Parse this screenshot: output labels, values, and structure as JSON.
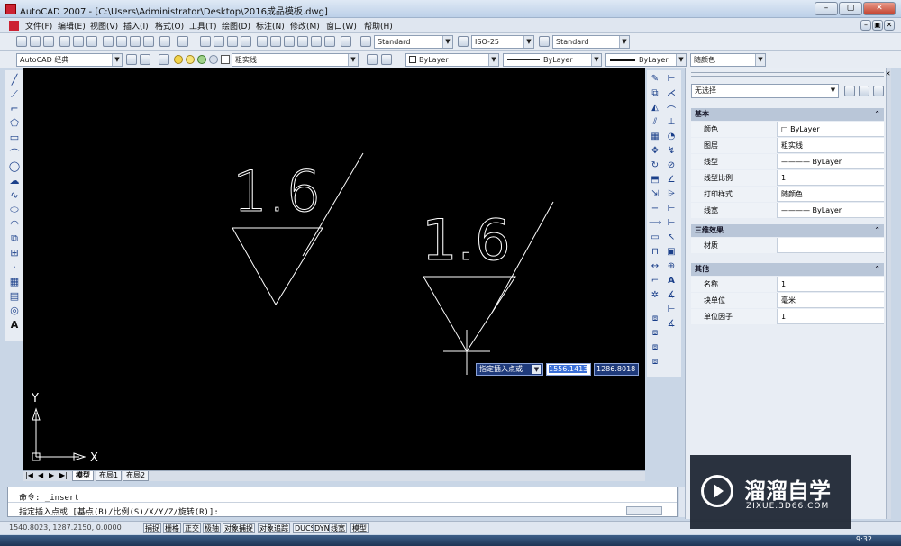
{
  "window": {
    "title": "AutoCAD 2007 - [C:\\Users\\Administrator\\Desktop\\2016成品模板.dwg]",
    "min": "–",
    "max": "▢",
    "close": "✕"
  },
  "menu": [
    "文件(F)",
    "编辑(E)",
    "视图(V)",
    "插入(I)",
    "格式(O)",
    "工具(T)",
    "绘图(D)",
    "标注(N)",
    "修改(M)",
    "窗口(W)",
    "帮助(H)"
  ],
  "toolbar": {
    "text_style": "Standard",
    "dim_style": "ISO-25",
    "table_style": "Standard",
    "workspace": "AutoCAD 经典",
    "layer": "粗实线",
    "color": "ByLayer",
    "linetype": "ByLayer",
    "lineweight": "ByLayer",
    "plotstyle": "随颜色"
  },
  "canvas": {
    "symbol_text_1": "1.6",
    "symbol_text_2": "1.6",
    "ucs_y": "Y",
    "ucs_x": "X",
    "dyn_prompt": "指定插入点或",
    "dyn_x": "1556.1413",
    "dyn_y": "1286.8018"
  },
  "tabs": [
    "模型",
    "布局1",
    "布局2"
  ],
  "command": {
    "line1": "命令: _insert",
    "line2": "指定插入点或 [基点(B)/比例(S)/X/Y/Z/旋转(R)]:"
  },
  "status": {
    "coords": "1540.8023, 1287.2150, 0.0000",
    "buttons": [
      "捕捉",
      "栅格",
      "正交",
      "极轴",
      "对象捕捉",
      "对象追踪",
      "DUCS",
      "DYN",
      "线宽",
      "模型"
    ]
  },
  "palette": {
    "selection": "无选择",
    "sections": {
      "basic": "基本",
      "three_d": "三维效果",
      "misc": "其他"
    },
    "basic_rows": [
      {
        "label": "颜色",
        "value": "□ ByLayer"
      },
      {
        "label": "图层",
        "value": "粗实线"
      },
      {
        "label": "线型",
        "value": "———— ByLayer"
      },
      {
        "label": "线型比例",
        "value": "1"
      },
      {
        "label": "打印样式",
        "value": "随颜色"
      },
      {
        "label": "线宽",
        "value": "———— ByLayer"
      }
    ],
    "three_d_rows": [
      {
        "label": "材质",
        "value": ""
      }
    ],
    "misc_rows": [
      {
        "label": "名称",
        "value": "1"
      },
      {
        "label": "块单位",
        "value": "毫米"
      },
      {
        "label": "单位因子",
        "value": "1"
      }
    ]
  },
  "watermark": {
    "brand": "溜溜自学",
    "url": "ZIXUE.3D66.COM"
  },
  "taskbar": {
    "clock": "9:32"
  }
}
